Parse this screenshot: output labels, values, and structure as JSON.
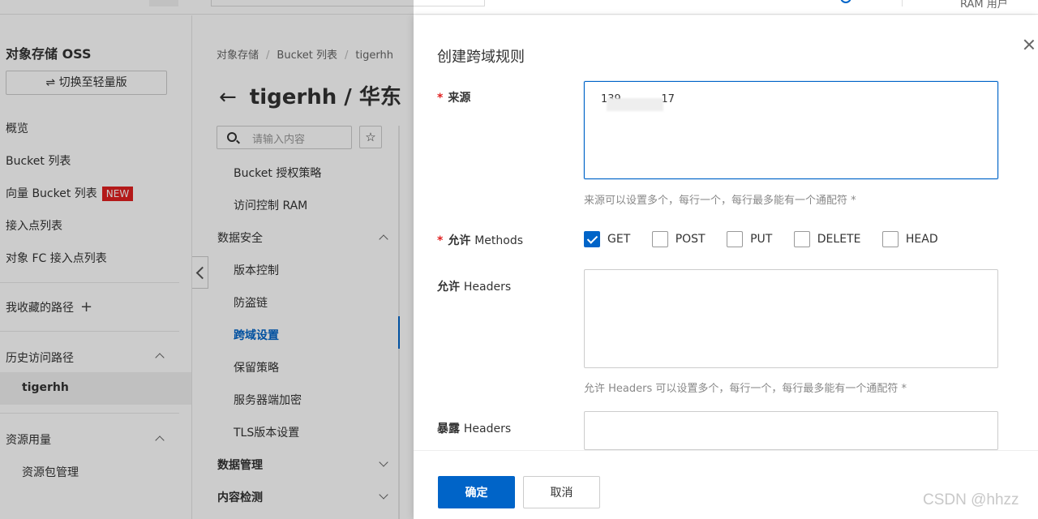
{
  "topbar": {
    "user_label": "RAM 用户"
  },
  "sidebar": {
    "title": "对象存储 OSS",
    "switch_label": "⇌ 切换至轻量版",
    "items": [
      "概览",
      "Bucket 列表",
      "向量 Bucket 列表",
      "接入点列表",
      "对象 FC 接入点列表"
    ],
    "new_badge": "NEW",
    "favorites_label": "我收藏的路径",
    "history_label": "历史访问路径",
    "history_item": "tigerhh",
    "resource_label": "资源用量",
    "resource_item": "资源包管理"
  },
  "midpanel": {
    "breadcrumb": [
      "对象存储",
      "Bucket 列表",
      "tigerhh"
    ],
    "title": "tigerhh / 华东",
    "search_placeholder": "请输入内容",
    "menu": {
      "bucket_policy": "Bucket 授权策略",
      "ram": "访问控制 RAM",
      "data_security": "数据安全",
      "versioning": "版本控制",
      "hotlink": "防盗链",
      "cors": "跨域设置",
      "retention": "保留策略",
      "encryption": "服务器端加密",
      "tls": "TLS版本设置",
      "data_mgmt": "数据管理",
      "content_check": "内容检测"
    }
  },
  "drawer": {
    "title": "创建跨域规则",
    "source_label": "来源",
    "source_value": "139.          .17",
    "source_hint": "来源可以设置多个，每行一个，每行最多能有一个通配符 *",
    "methods_label_cn": "允许",
    "methods_label_en": "Methods",
    "methods": [
      {
        "label": "GET",
        "checked": true
      },
      {
        "label": "POST",
        "checked": false
      },
      {
        "label": "PUT",
        "checked": false
      },
      {
        "label": "DELETE",
        "checked": false
      },
      {
        "label": "HEAD",
        "checked": false
      }
    ],
    "headers_label_cn": "允许",
    "headers_label_en": "Headers",
    "headers_hint": "允许 Headers 可以设置多个，每行一个，每行最多能有一个通配符 *",
    "expose_label_cn": "暴露",
    "expose_label_en": "Headers",
    "confirm": "确定",
    "cancel": "取消"
  },
  "watermark": "CSDN @hhzz",
  "colors": {
    "primary": "#0064c8",
    "required": "#e02020",
    "badge": "#e02020"
  }
}
